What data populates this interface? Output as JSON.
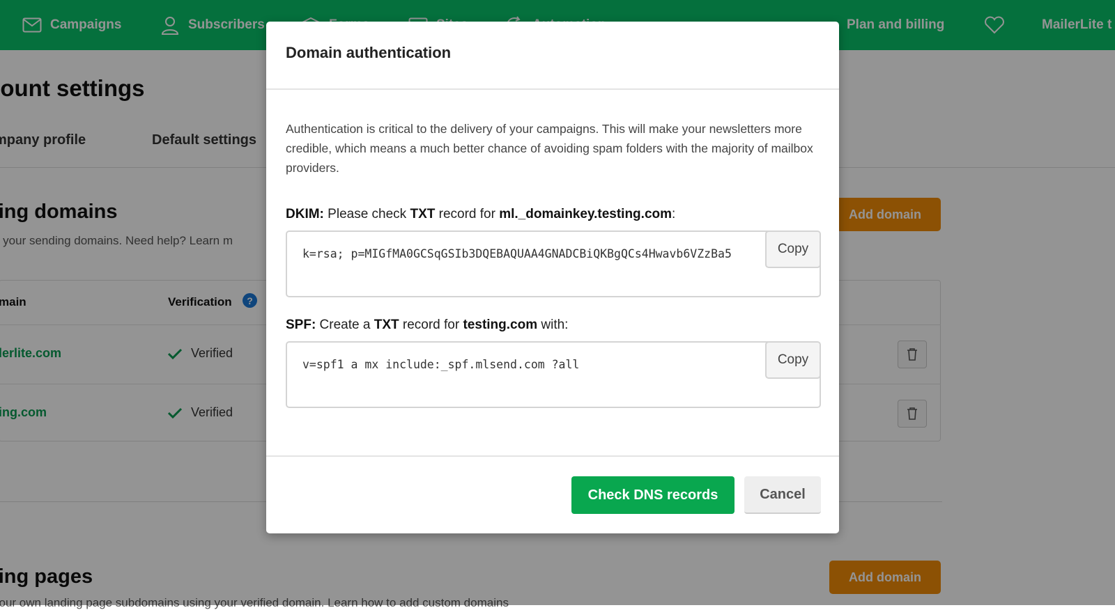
{
  "nav": {
    "items": [
      {
        "label": "Campaigns",
        "icon": "envelope-icon"
      },
      {
        "label": "Subscribers",
        "icon": "user-icon"
      },
      {
        "label": "Forms",
        "icon": "forms-icon"
      },
      {
        "label": "Sites",
        "icon": "browser-icon"
      },
      {
        "label": "Automation",
        "icon": "refresh-icon"
      }
    ],
    "plan_billing": "Plan and billing",
    "account": "MailerLite t"
  },
  "page": {
    "title": "Account settings",
    "title_visible": "count settings",
    "tabs": [
      "mpany profile",
      "Default settings"
    ]
  },
  "sending_domains": {
    "title": "ding domains",
    "subtitle": "e your sending domains. Need help? Learn m",
    "add_button": "Add domain",
    "columns": [
      "main",
      "Verification"
    ],
    "rows": [
      {
        "domain": "lerlite.com",
        "status": "Verified"
      },
      {
        "domain": "ing.com",
        "status": "Verified"
      }
    ]
  },
  "landing_pages": {
    "title": "ding pages",
    "subtitle": "your own landing page subdomains using your verified domain. Learn how to add custom domains",
    "add_button": "Add domain"
  },
  "modal": {
    "title": "Domain authentication",
    "description": "Authentication is critical to the delivery of your campaigns. This will make your newsletters more credible, which means a much better chance of avoiding spam folders with the majority of mailbox providers.",
    "dkim": {
      "label_prefix": "DKIM:",
      "label_text1": " Please check ",
      "label_type": "TXT",
      "label_text2": " record for ",
      "label_host": "ml._domainkey.testing.com",
      "label_suffix": ":",
      "value": "k=rsa; p=MIGfMA0GCSqGSIb3DQEBAQUAA4GNADCBiQKBgQCs4Hwavb6VZzBa5",
      "copy": "Copy"
    },
    "spf": {
      "label_prefix": "SPF:",
      "label_text1": " Create a ",
      "label_type": "TXT",
      "label_text2": " record for ",
      "label_host": "testing.com",
      "label_suffix": " with:",
      "value": "v=spf1 a mx include:_spf.mlsend.com ?all",
      "copy": "Copy"
    },
    "check_button": "Check DNS records",
    "cancel_button": "Cancel"
  },
  "colors": {
    "nav_green": "#09c269",
    "primary_green": "#09a74f",
    "link_green": "#0a9a52",
    "orange": "#f18c08",
    "help_blue": "#1a78d6"
  }
}
